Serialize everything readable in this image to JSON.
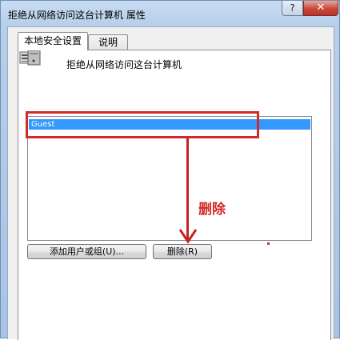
{
  "window": {
    "title": "拒绝从网络访问这台计算机 属性",
    "help_glyph": "?",
    "close_glyph": "✕"
  },
  "tabs": [
    {
      "label": "本地安全设置",
      "selected": true
    },
    {
      "label": "说明",
      "selected": false
    }
  ],
  "policy": {
    "icon": "server-computer-icon",
    "title": "拒绝从网络访问这台计算机"
  },
  "list": {
    "items": [
      {
        "label": "Guest",
        "selected": true
      }
    ]
  },
  "buttons": {
    "add_label": "添加用户或组(U)...",
    "remove_label": "删除(R)"
  },
  "annotation": {
    "label": "删除",
    "color": "#d22a2a"
  },
  "colors": {
    "selection": "#3399ff",
    "titlebar": "#b7cfe9",
    "close_button": "#c8483a"
  }
}
